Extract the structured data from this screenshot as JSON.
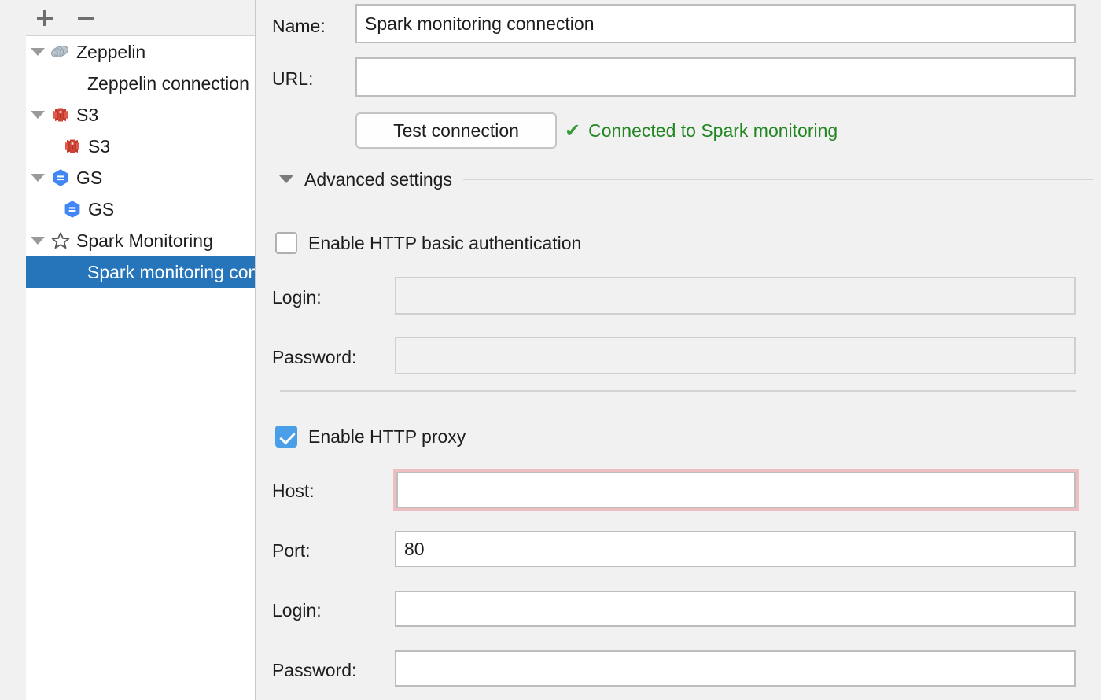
{
  "tree": {
    "toolbar": {
      "add_label": "+",
      "remove_label": "−",
      "add_icon": "plus-icon",
      "remove_icon": "minus-icon"
    },
    "items": [
      {
        "label": "Zeppelin",
        "icon": "zeppelin-icon",
        "level": 0,
        "expanded": true,
        "selected": false
      },
      {
        "label": "Zeppelin connection",
        "icon": "none",
        "level": 1,
        "expanded": false,
        "selected": false
      },
      {
        "label": "S3",
        "icon": "s3-icon",
        "level": 0,
        "expanded": true,
        "selected": false
      },
      {
        "label": "S3",
        "icon": "s3-icon",
        "level": 1,
        "expanded": false,
        "selected": false
      },
      {
        "label": "GS",
        "icon": "gs-icon",
        "level": 0,
        "expanded": true,
        "selected": false
      },
      {
        "label": "GS",
        "icon": "gs-icon",
        "level": 1,
        "expanded": false,
        "selected": false
      },
      {
        "label": "Spark Monitoring",
        "icon": "star-icon",
        "level": 0,
        "expanded": true,
        "selected": false
      },
      {
        "label": "Spark monitoring connection",
        "icon": "none",
        "level": 1,
        "expanded": false,
        "selected": true
      }
    ]
  },
  "form": {
    "name_label": "Name:",
    "name_value": "Spark monitoring connection",
    "url_label": "URL:",
    "url_value": "",
    "test_button_label": "Test connection",
    "status_icon": "check-icon",
    "status_text": "Connected to Spark monitoring",
    "status_color": "#218621",
    "advanced_title": "Advanced settings",
    "basic_auth": {
      "checkbox_label": "Enable HTTP basic authentication",
      "checked": false,
      "login_label": "Login:",
      "login_value": "",
      "password_label": "Password:",
      "password_value": ""
    },
    "proxy": {
      "checkbox_label": "Enable HTTP proxy",
      "checked": true,
      "host_label": "Host:",
      "host_value": "",
      "host_error": true,
      "port_label": "Port:",
      "port_value": "80",
      "login_label": "Login:",
      "login_value": "",
      "password_label": "Password:",
      "password_value": ""
    }
  },
  "colors": {
    "selection_blue": "#2675bb",
    "checkbox_blue": "#4b9fe8",
    "error_outline": "#eebfc2",
    "success_green": "#218621",
    "panel_bg": "#f1f1f1"
  }
}
